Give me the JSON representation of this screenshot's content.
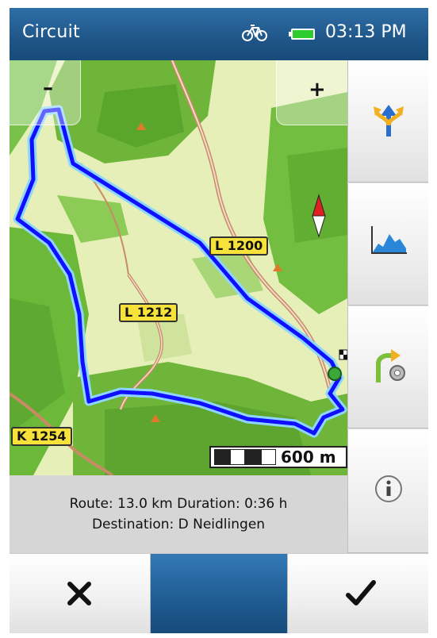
{
  "header": {
    "title": "Circuit",
    "time": "03:13 PM",
    "icons": [
      "bicycle-icon",
      "battery-icon"
    ]
  },
  "map": {
    "zoom_out_label": "–",
    "zoom_in_label": "+",
    "road_labels": [
      "L 1200",
      "L 1212",
      "K 1254"
    ],
    "scale_label": "600 m",
    "colors": {
      "route": "#1010ff",
      "route_glow": "#8fd6ff",
      "forest": "#6fba3c",
      "meadow": "#e6efb8"
    }
  },
  "route_info": {
    "route_line": "Route: 13.0 km Duration: 0:36 h",
    "destination_line": "Destination: D Neidlingen"
  },
  "sidebar": {
    "buttons": [
      "route-options-icon",
      "elevation-profile-icon",
      "route-settings-icon",
      "info-icon"
    ]
  },
  "bottom_bar": {
    "cancel_icon": "close-icon",
    "confirm_icon": "checkmark-icon",
    "accent": "#1f5b92"
  }
}
